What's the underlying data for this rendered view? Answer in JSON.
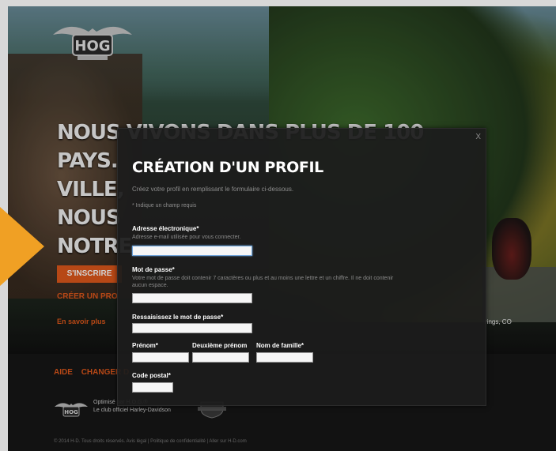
{
  "brand": {
    "logo_icon": "hog-eagle-logo-icon",
    "footer_hd_icon": "harley-davidson-shield-icon"
  },
  "hero": {
    "lines": [
      "NOUS VIVONS DANS PLUS DE 100",
      "PAYS.",
      "VILLE,",
      "NOUS",
      "NOTRE"
    ],
    "join_button": "S'INSCRIRE",
    "create_profile_link": "CRÉER UN PRO",
    "learn_more_link": "En savoir plus",
    "photo_location": "rings, CO"
  },
  "footer": {
    "links": [
      "AIDE",
      "CHANGER D"
    ],
    "tagline_line1": "Optimisé par H.O.G.®",
    "tagline_line2": "Le club officiel Harley-Davidson",
    "copyright": "© 2014 H-D. Tous droits réservés. Avis légal | Politique de confidentialité | Aller sur H-D.com"
  },
  "modal": {
    "close_label": "X",
    "title": "CRÉATION D'UN PROFIL",
    "intro": "Créez votre profil en remplissant le formulaire ci-dessous.",
    "required_note": "* Indique un champ requis",
    "fields": {
      "email": {
        "label": "Adresse électronique*",
        "help": "Adresse e-mail utilisée pour vous connecter.",
        "value": ""
      },
      "password": {
        "label": "Mot de passe*",
        "help_line1": "Votre mot de passe doit contenir 7 caractères ou plus et au moins une lettre et un chiffre. Il ne doit contenir",
        "help_line2": "aucun espace.",
        "value": ""
      },
      "password_confirm": {
        "label": "Ressaisissez le mot de passe*",
        "value": ""
      },
      "first_name": {
        "label": "Prénom*",
        "value": ""
      },
      "middle_name": {
        "label": "Deuxième prénom",
        "value": ""
      },
      "last_name": {
        "label": "Nom de famille*",
        "value": ""
      },
      "postal_code": {
        "label": "Code postal*",
        "value": ""
      }
    }
  },
  "colors": {
    "accent_orange": "#e0581b",
    "arrow_orange": "#f0a024",
    "modal_bg": "#1c1c1c",
    "focus_blue": "#6fa3d8"
  }
}
